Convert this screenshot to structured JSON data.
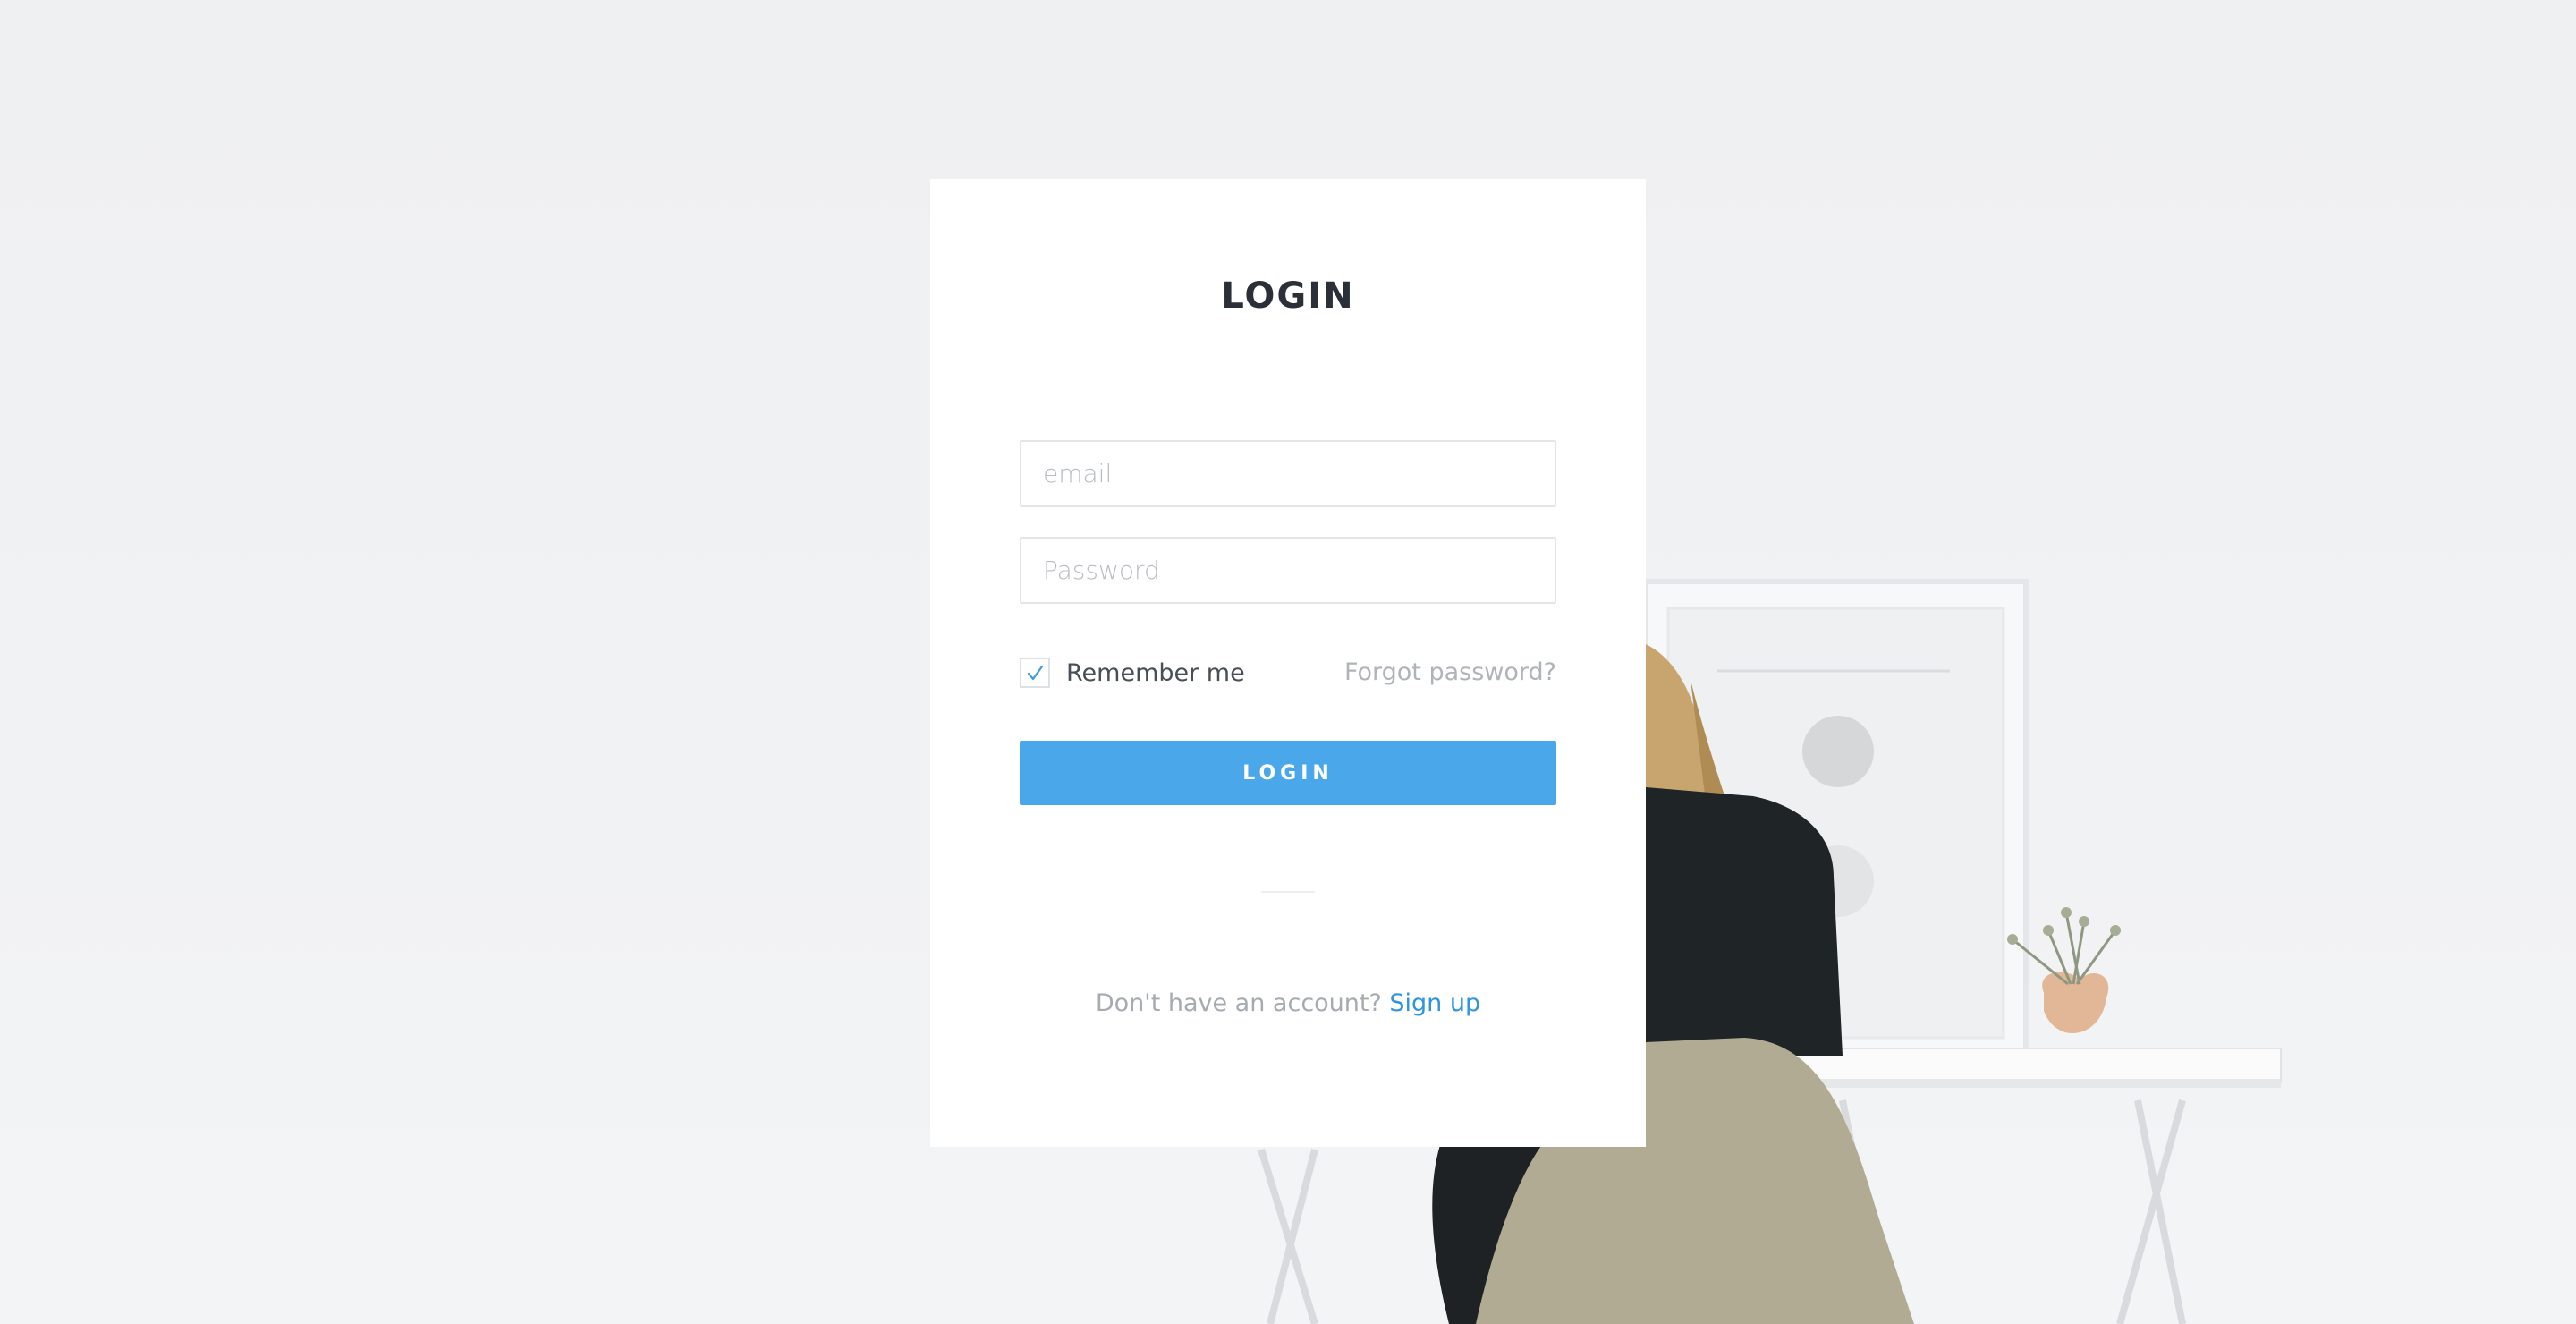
{
  "login": {
    "title": "LOGIN",
    "email_placeholder": "email",
    "password_placeholder": "Password",
    "remember_label": "Remember me",
    "remember_checked": true,
    "forgot_label": "Forgot password?",
    "button_label": "LOGIN",
    "signup_prompt": "Don't have an account?",
    "signup_link": "Sign up"
  },
  "icons": {
    "checkbox_check": "check-icon"
  },
  "colors": {
    "accent": "#4aa8ea",
    "link": "#2d95dc",
    "title": "#2b3038",
    "background": "#eef0f2"
  }
}
